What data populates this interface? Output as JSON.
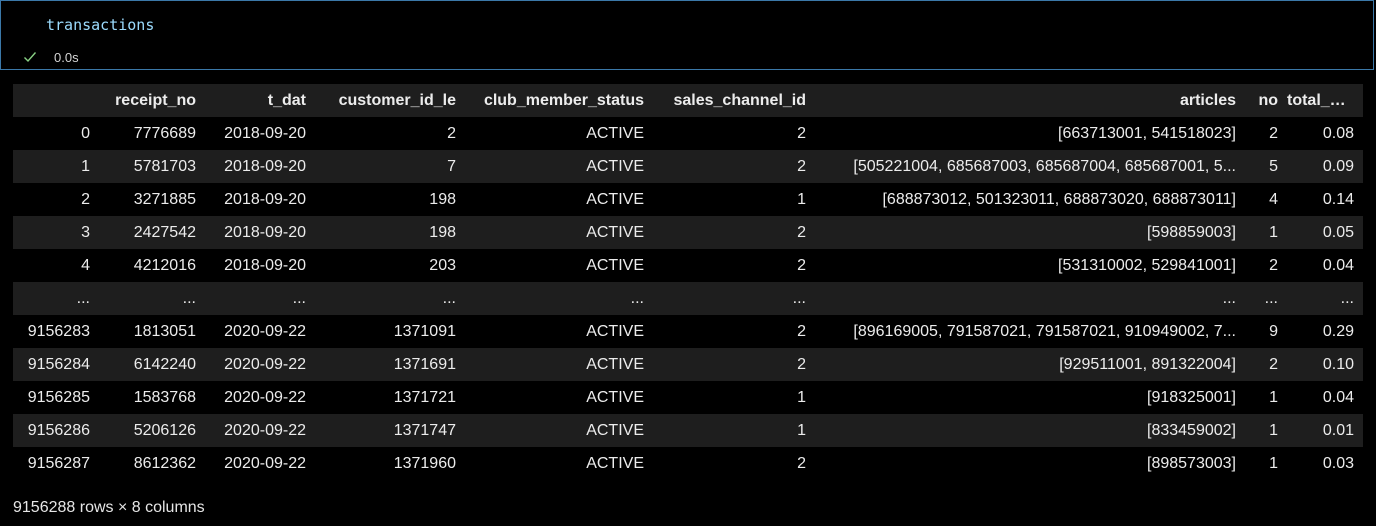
{
  "cell": {
    "code": "transactions",
    "status_time": "0.0s"
  },
  "table": {
    "columns": [
      "",
      "receipt_no",
      "t_dat",
      "customer_id_le",
      "club_member_status",
      "sales_channel_id",
      "articles",
      "no",
      "total_price"
    ],
    "rows": [
      [
        "0",
        "7776689",
        "2018-09-20",
        "2",
        "ACTIVE",
        "2",
        "[663713001, 541518023]",
        "2",
        "0.08"
      ],
      [
        "1",
        "5781703",
        "2018-09-20",
        "7",
        "ACTIVE",
        "2",
        "[505221004, 685687003, 685687004, 685687001, 5...",
        "5",
        "0.09"
      ],
      [
        "2",
        "3271885",
        "2018-09-20",
        "198",
        "ACTIVE",
        "1",
        "[688873012, 501323011, 688873020, 688873011]",
        "4",
        "0.14"
      ],
      [
        "3",
        "2427542",
        "2018-09-20",
        "198",
        "ACTIVE",
        "2",
        "[598859003]",
        "1",
        "0.05"
      ],
      [
        "4",
        "4212016",
        "2018-09-20",
        "203",
        "ACTIVE",
        "2",
        "[531310002, 529841001]",
        "2",
        "0.04"
      ],
      [
        "...",
        "...",
        "...",
        "...",
        "...",
        "...",
        "...",
        "...",
        "..."
      ],
      [
        "9156283",
        "1813051",
        "2020-09-22",
        "1371091",
        "ACTIVE",
        "2",
        "[896169005, 791587021, 791587021, 910949002, 7...",
        "9",
        "0.29"
      ],
      [
        "9156284",
        "6142240",
        "2020-09-22",
        "1371691",
        "ACTIVE",
        "2",
        "[929511001, 891322004]",
        "2",
        "0.10"
      ],
      [
        "9156285",
        "1583768",
        "2020-09-22",
        "1371721",
        "ACTIVE",
        "1",
        "[918325001]",
        "1",
        "0.04"
      ],
      [
        "9156286",
        "5206126",
        "2020-09-22",
        "1371747",
        "ACTIVE",
        "1",
        "[833459002]",
        "1",
        "0.01"
      ],
      [
        "9156287",
        "8612362",
        "2020-09-22",
        "1371960",
        "ACTIVE",
        "2",
        "[898573003]",
        "1",
        "0.03"
      ]
    ]
  },
  "summary": "9156288 rows × 8 columns",
  "colors": {
    "cell_border": "#3b78a8",
    "code_text": "#9cdcfe",
    "check": "#89d185",
    "row_alt": "#1e1e1e"
  },
  "icons": {
    "status": "check-icon"
  }
}
